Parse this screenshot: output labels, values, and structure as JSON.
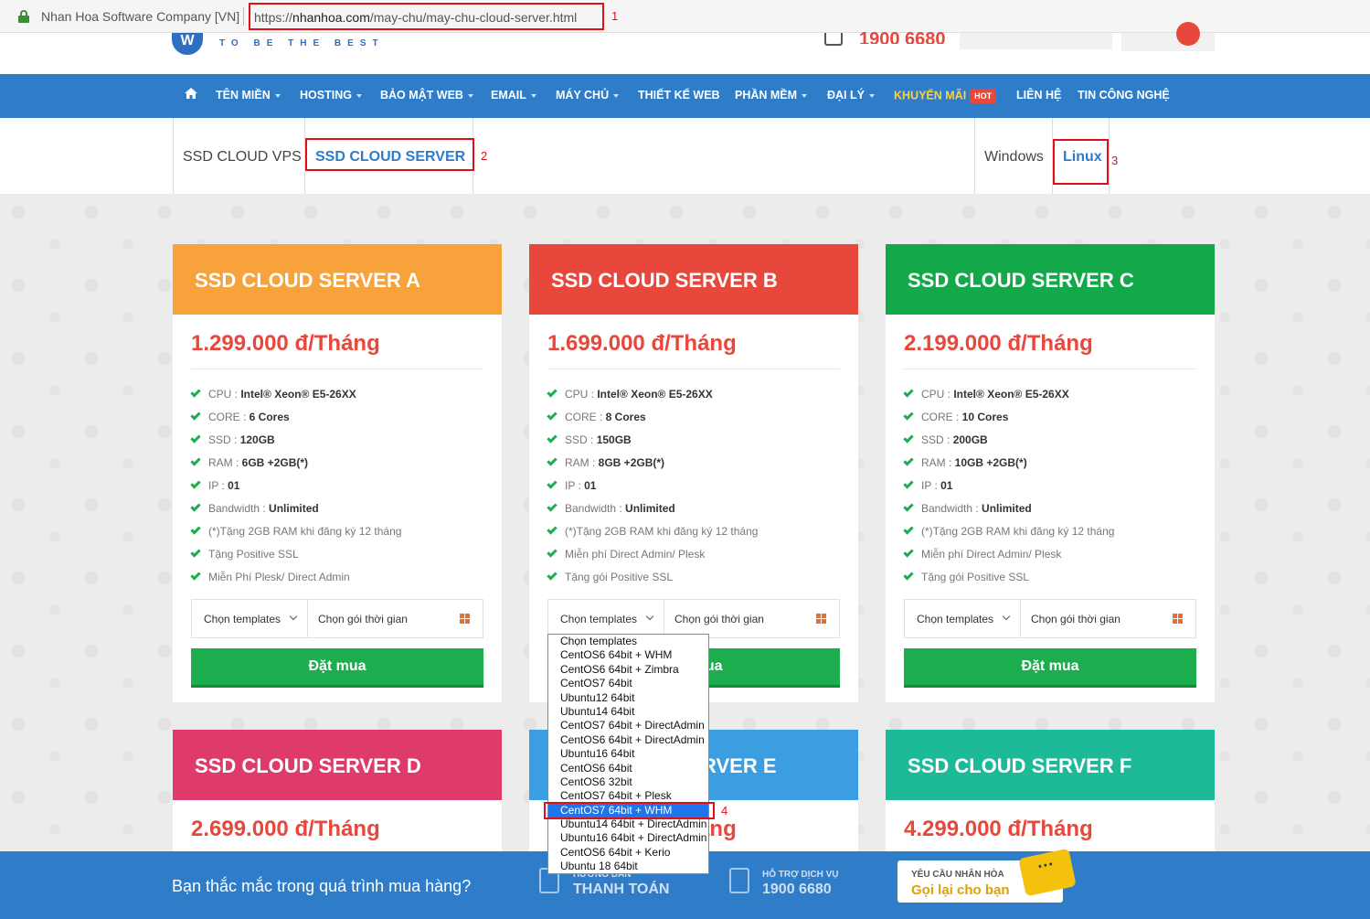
{
  "browser": {
    "site_identity": "Nhan Hoa Software Company [VN]",
    "url_prefix": "https://",
    "url_domain": "nhanhoa.com",
    "url_path": "/may-chu/may-chu-cloud-server.html"
  },
  "annotations": {
    "a1": "1",
    "a2": "2",
    "a3": "3",
    "a4": "4"
  },
  "header": {
    "logo_letter": "W",
    "tagline": "TO BE THE BEST",
    "phone": "1900 6680"
  },
  "nav": {
    "items": [
      {
        "label": "TÊN MIỀN",
        "caret": true
      },
      {
        "label": "HOSTING",
        "caret": true
      },
      {
        "label": "BẢO MẬT WEB",
        "caret": true
      },
      {
        "label": "EMAIL",
        "caret": true
      },
      {
        "label": "MÁY CHỦ",
        "caret": true
      },
      {
        "label": "THIẾT KẾ WEB",
        "caret": false
      },
      {
        "label": "PHẦN MỀM",
        "caret": true
      },
      {
        "label": "ĐẠI LÝ",
        "caret": true
      },
      {
        "label": "KHUYẾN MÃI",
        "caret": false
      },
      {
        "label": "LIÊN HỆ",
        "caret": false
      },
      {
        "label": "TIN CÔNG NGHỆ",
        "caret": false
      }
    ],
    "hot_badge": "HOT"
  },
  "tabs": {
    "left": [
      "SSD CLOUD VPS",
      "SSD CLOUD SERVER"
    ],
    "right": [
      "Windows",
      "Linux"
    ]
  },
  "cards": [
    {
      "title": "SSD CLOUD SERVER A",
      "color": "#f7a23b",
      "price": "1.299.000 đ/Tháng",
      "cpu": "Intel® Xeon® E5-26XX",
      "core": "6 Cores",
      "ssd": "120GB",
      "ram": "6GB +2GB(*)",
      "ip": "01",
      "bandwidth": "Unlimited",
      "extra1": "(*)Tặng 2GB RAM khi đăng ký 12 tháng",
      "extra2": "Tặng Positive SSL",
      "extra3": "Miễn Phí Plesk/ Direct Admin"
    },
    {
      "title": "SSD CLOUD SERVER B",
      "color": "#e8473c",
      "price": "1.699.000 đ/Tháng",
      "cpu": "Intel® Xeon® E5-26XX",
      "core": "8 Cores",
      "ssd": "150GB",
      "ram": "8GB +2GB(*)",
      "ip": "01",
      "bandwidth": "Unlimited",
      "extra1": "(*)Tặng 2GB RAM khi đăng ký 12 tháng",
      "extra2": "Miễn phí Direct Admin/ Plesk",
      "extra3": "Tặng gói Positive SSL"
    },
    {
      "title": "SSD CLOUD SERVER C",
      "color": "#13a94a",
      "price": "2.199.000 đ/Tháng",
      "cpu": "Intel® Xeon® E5-26XX",
      "core": "10 Cores",
      "ssd": "200GB",
      "ram": "10GB +2GB(*)",
      "ip": "01",
      "bandwidth": "Unlimited",
      "extra1": "(*)Tặng 2GB RAM khi đăng ký 12 tháng",
      "extra2": "Miễn phí Direct Admin/ Plesk",
      "extra3": "Tặng gói Positive SSL"
    }
  ],
  "cards_row2": [
    {
      "title": "SSD CLOUD SERVER D",
      "color": "#de3b6b",
      "price": "2.699.000 đ/Tháng"
    },
    {
      "title": "SSD CLOUD SERVER E",
      "color": "#3b9ee0",
      "price": "3.499.000 đ/Tháng"
    },
    {
      "title": "SSD CLOUD SERVER F",
      "color": "#1dba9a",
      "price": "4.299.000 đ/Tháng"
    }
  ],
  "labels": {
    "cpu": "CPU : ",
    "core": "CORE : ",
    "ssd": "SSD : ",
    "ram": "RAM : ",
    "ip": "IP : ",
    "bandwidth": "Bandwidth : ",
    "choose_template": "Chọn templates",
    "choose_period": "Chọn gói thời gian",
    "buy": "Đặt mua"
  },
  "dropdown": {
    "options": [
      "Chọn templates",
      "CentOS6 64bit + WHM",
      "CentOS6 64bit + Zimbra",
      "CentOS7 64bit",
      "Ubuntu12 64bit",
      "Ubuntu14 64bit",
      "CentOS7 64bit + DirectAdmin",
      "CentOS6 64bit + DirectAdmin",
      "Ubuntu16 64bit",
      "CentOS6 64bit",
      "CentOS6 32bit",
      "CentOS7 64bit + Plesk",
      "CentOS7 64bit + WHM",
      "Ubuntu14 64bit + DirectAdmin",
      "Ubuntu16 64bit + DirectAdmin",
      "CentOS6 64bit + Kerio",
      "Ubuntu 18 64bit"
    ],
    "highlighted": "CentOS7 64bit + WHM"
  },
  "footer": {
    "question": "Bạn thắc mắc trong quá trình mua hàng?",
    "guide_small": "HƯỚNG DẪN",
    "guide_big": "THANH TOÁN",
    "support_small": "HỖ TRỢ DỊCH VỤ",
    "support_big": "1900 6680",
    "callback_small": "YÊU CẦU NHÂN HÒA",
    "callback_big": "Gọi lại cho bạn",
    "bubble": "···"
  }
}
